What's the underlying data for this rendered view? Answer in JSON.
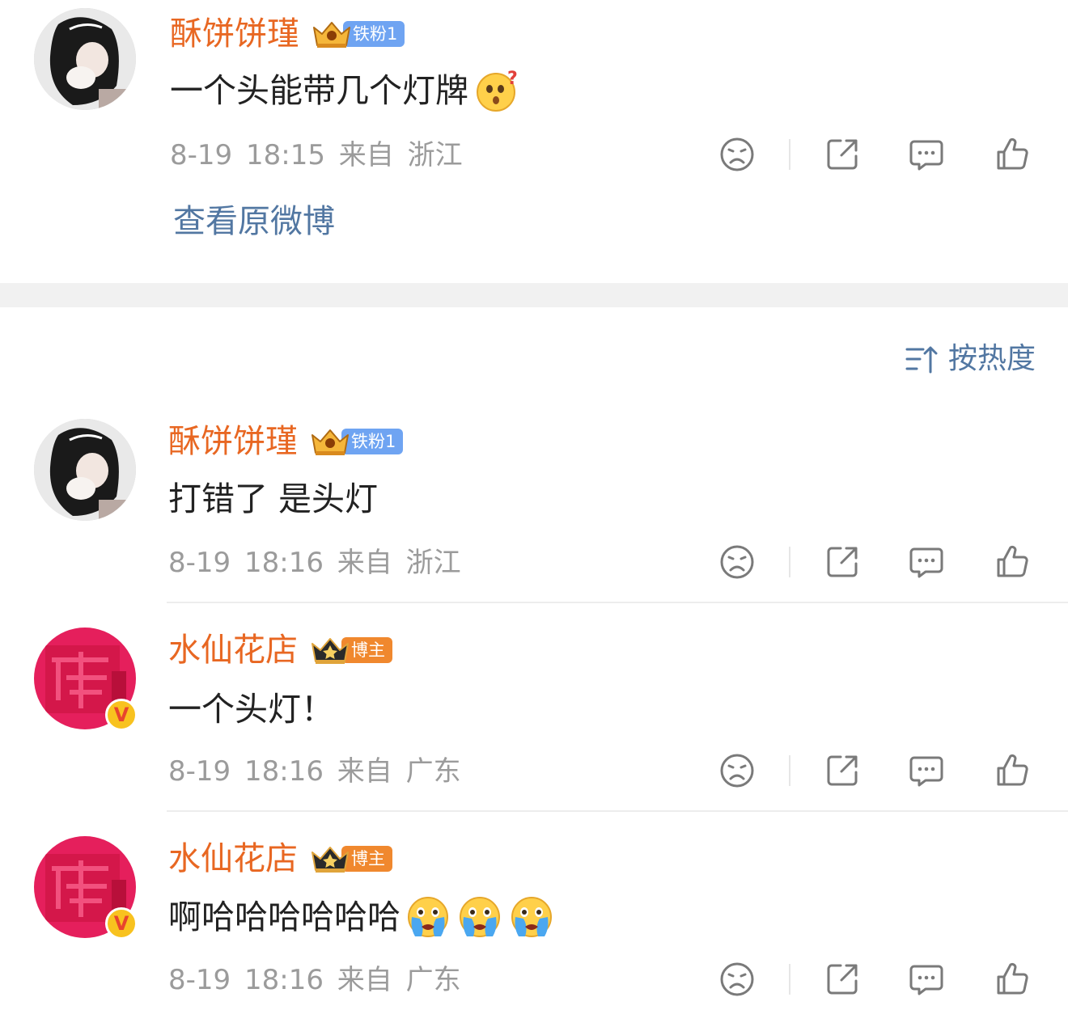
{
  "original_post": {
    "username": "酥饼饼瑾",
    "badge_label": "铁粉1",
    "text": "一个头能带几个灯牌",
    "emoji": "surprised-question-emoji",
    "time": "8-19 18:15",
    "source": "来自 浙江",
    "view_original_link": "查看原微博"
  },
  "sort": {
    "label": "按热度"
  },
  "replies": [
    {
      "username": "酥饼饼瑾",
      "badge_label": "铁粉1",
      "text": "打错了 是头灯",
      "time": "8-19 18:16",
      "source": "来自 浙江",
      "verified": false
    },
    {
      "username": "水仙花店",
      "badge_label": "博主",
      "text": "一个头灯！",
      "time": "8-19 18:16",
      "source": "来自 广东",
      "verified": true
    },
    {
      "username": "水仙花店",
      "badge_label": "博主",
      "text": "啊哈哈哈哈哈哈",
      "emoji": "crying-emoji",
      "emoji_count": 3,
      "time": "8-19 18:16",
      "source": "来自 广东",
      "verified": true
    }
  ],
  "colors": {
    "username": "#e86722",
    "link": "#5277a2",
    "meta": "#9b9b9b",
    "fan_badge": "#6fa4f2",
    "host_badge": "#f0882e",
    "separator_band": "#f1f1f1"
  }
}
